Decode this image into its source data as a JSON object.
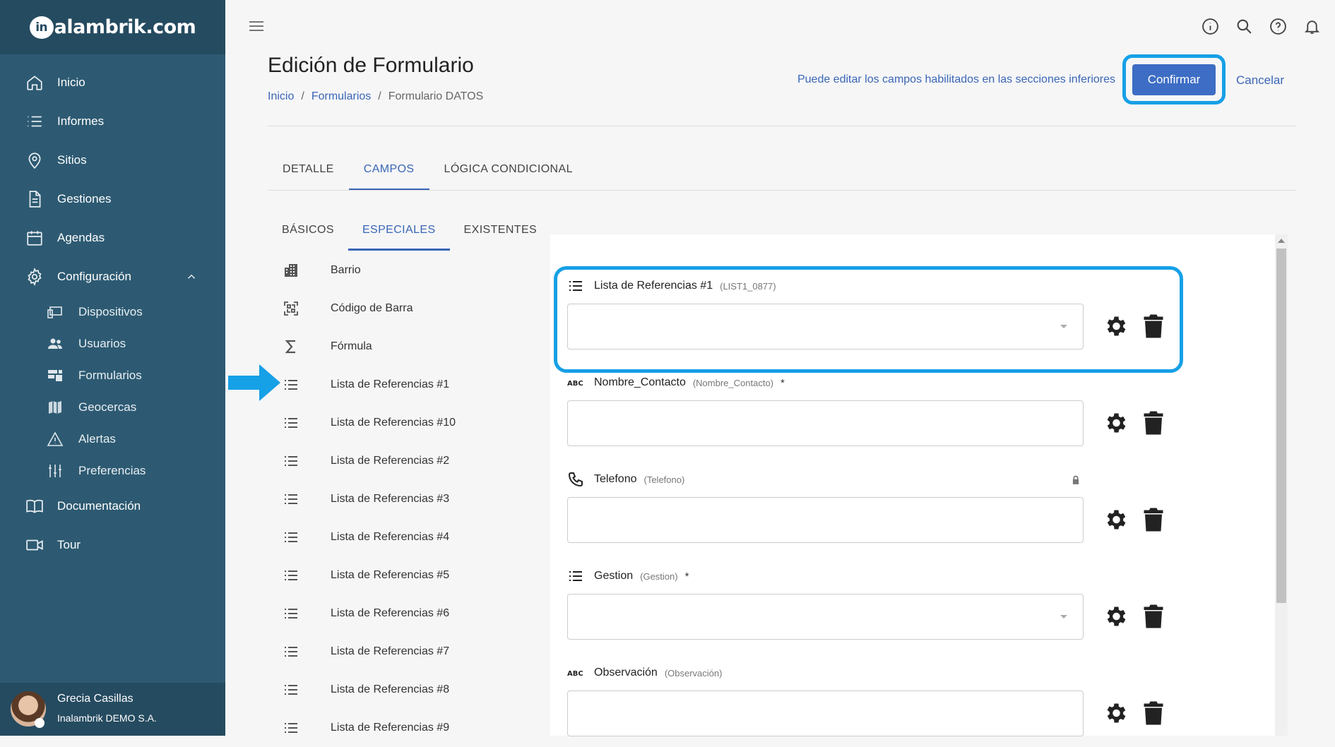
{
  "brand": {
    "logo_letter": "in",
    "logo_rest": "alambrik.com"
  },
  "sidebar": {
    "items": [
      {
        "label": "Inicio",
        "icon": "home-icon"
      },
      {
        "label": "Informes",
        "icon": "list-icon"
      },
      {
        "label": "Sitios",
        "icon": "map-pin-icon"
      },
      {
        "label": "Gestiones",
        "icon": "document-icon"
      },
      {
        "label": "Agendas",
        "icon": "calendar-icon"
      },
      {
        "label": "Configuración",
        "icon": "gear-icon"
      },
      {
        "label": "Documentación",
        "icon": "book-icon"
      },
      {
        "label": "Tour",
        "icon": "video-icon"
      }
    ],
    "subitems": [
      {
        "label": "Dispositivos",
        "icon": "devices-icon"
      },
      {
        "label": "Usuarios",
        "icon": "users-icon"
      },
      {
        "label": "Formularios",
        "icon": "forms-icon"
      },
      {
        "label": "Geocercas",
        "icon": "map-icon"
      },
      {
        "label": "Alertas",
        "icon": "warning-icon"
      },
      {
        "label": "Preferencias",
        "icon": "sliders-icon"
      }
    ],
    "user": {
      "name": "Grecia Casillas",
      "org": "Inalambrik DEMO S.A."
    }
  },
  "header": {
    "title": "Edición de Formulario",
    "breadcrumb": [
      "Inicio",
      "Formularios",
      "Formulario DATOS"
    ],
    "breadcrumb_sep": "/",
    "hint": "Puede editar los campos habilitados en las secciones inferiores",
    "confirm_label": "Confirmar",
    "cancel_label": "Cancelar"
  },
  "tabs": [
    "DETALLE",
    "CAMPOS",
    "LÓGICA CONDICIONAL"
  ],
  "active_tab": "CAMPOS",
  "subtabs": [
    "BÁSICOS",
    "ESPECIALES",
    "EXISTENTES"
  ],
  "active_subtab": "ESPECIALES",
  "field_types": [
    {
      "label": "Barrio",
      "icon": "building-icon"
    },
    {
      "label": "Código de Barra",
      "icon": "qr-code-icon"
    },
    {
      "label": "Fórmula",
      "icon": "sigma-icon"
    },
    {
      "label": "Lista de Referencias #1",
      "icon": "list-icon"
    },
    {
      "label": "Lista de Referencias #10",
      "icon": "list-icon"
    },
    {
      "label": "Lista de Referencias #2",
      "icon": "list-icon"
    },
    {
      "label": "Lista de Referencias #3",
      "icon": "list-icon"
    },
    {
      "label": "Lista de Referencias #4",
      "icon": "list-icon"
    },
    {
      "label": "Lista de Referencias #5",
      "icon": "list-icon"
    },
    {
      "label": "Lista de Referencias #6",
      "icon": "list-icon"
    },
    {
      "label": "Lista de Referencias #7",
      "icon": "list-icon"
    },
    {
      "label": "Lista de Referencias #8",
      "icon": "list-icon"
    },
    {
      "label": "Lista de Referencias #9",
      "icon": "list-icon"
    }
  ],
  "form_fields": [
    {
      "name": "Lista de Referencias #1",
      "code": "(LIST1_0877)",
      "required": "",
      "type": "list",
      "icon": "list-icon",
      "value": ""
    },
    {
      "name": "Nombre_Contacto",
      "code": "(Nombre_Contacto)",
      "required": "*",
      "type": "text",
      "icon": "abc-icon",
      "value": ""
    },
    {
      "name": "Telefono",
      "code": "(Telefono)",
      "required": "",
      "type": "phone",
      "icon": "phone-icon",
      "value": ""
    },
    {
      "name": "Gestion",
      "code": "(Gestion)",
      "required": "*",
      "type": "list",
      "icon": "list-icon",
      "value": ""
    },
    {
      "name": "Observación",
      "code": "(Observación)",
      "required": "",
      "type": "text",
      "icon": "abc-icon",
      "value": ""
    }
  ],
  "icons": {
    "abc_glyph": "ABC"
  },
  "colors": {
    "sidebar": "#2d5a72",
    "sidebar_dark": "#254b60",
    "accent": "#3a66b5",
    "highlight": "#16a0e6"
  }
}
